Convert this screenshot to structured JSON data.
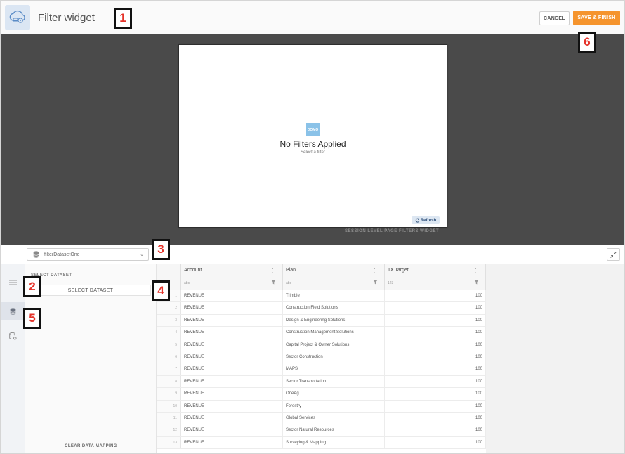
{
  "header": {
    "title": "Filter widget",
    "cancel_label": "CANCEL",
    "save_label": "SAVE & FINISH",
    "app_icon": "cloud-gear-icon"
  },
  "annotations": [
    "1",
    "2",
    "3",
    "4",
    "5",
    "6"
  ],
  "preview": {
    "logo_text": "DOMO",
    "empty_title": "No Filters Applied",
    "empty_subtitle": "Select a filter",
    "refresh_label": "Refresh",
    "caption": "SESSION LEVEL PAGE FILTERS WIDGET"
  },
  "data_panel": {
    "dataset_name": "filterDatasetOne",
    "side_heading": "SELECT DATASET",
    "select_button": "SELECT DATASET",
    "clear_label": "CLEAR DATA MAPPING",
    "help_label": "?"
  },
  "grid": {
    "columns": [
      {
        "name": "Account",
        "type": "abc"
      },
      {
        "name": "Plan",
        "type": "abc"
      },
      {
        "name": "1X Target",
        "type": "123"
      }
    ],
    "rows": [
      {
        "idx": "1",
        "account": "REVENUE",
        "plan": "Trimble",
        "target": "100"
      },
      {
        "idx": "2",
        "account": "REVENUE",
        "plan": "Construction Field Solutions",
        "target": "100"
      },
      {
        "idx": "3",
        "account": "REVENUE",
        "plan": "Design & Engineering Solutions",
        "target": "100"
      },
      {
        "idx": "4",
        "account": "REVENUE",
        "plan": "Construction Management Solutions",
        "target": "100"
      },
      {
        "idx": "5",
        "account": "REVENUE",
        "plan": "Capital Project & Owner Solutions",
        "target": "100"
      },
      {
        "idx": "6",
        "account": "REVENUE",
        "plan": "Sector Construction",
        "target": "100"
      },
      {
        "idx": "7",
        "account": "REVENUE",
        "plan": "MAPS",
        "target": "100"
      },
      {
        "idx": "8",
        "account": "REVENUE",
        "plan": "Sector Transportation",
        "target": "100"
      },
      {
        "idx": "9",
        "account": "REVENUE",
        "plan": "OneAg",
        "target": "100"
      },
      {
        "idx": "10",
        "account": "REVENUE",
        "plan": "Forestry",
        "target": "100"
      },
      {
        "idx": "11",
        "account": "REVENUE",
        "plan": "Global Services",
        "target": "100"
      },
      {
        "idx": "12",
        "account": "REVENUE",
        "plan": "Sector Natural Resources",
        "target": "100"
      },
      {
        "idx": "13",
        "account": "REVENUE",
        "plan": "Surveying & Mapping",
        "target": "100"
      }
    ]
  },
  "colors": {
    "accent": "#f5942d",
    "stage_bg": "#4a4a4a",
    "annotation_text": "#e5332a"
  }
}
